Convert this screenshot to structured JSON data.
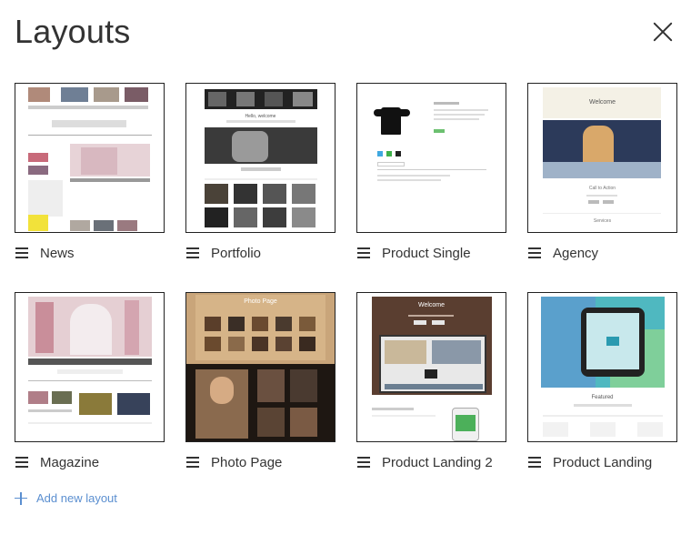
{
  "header": {
    "title": "Layouts"
  },
  "layouts": [
    {
      "label": "News"
    },
    {
      "label": "Portfolio"
    },
    {
      "label": "Product Single"
    },
    {
      "label": "Agency"
    },
    {
      "label": "Magazine"
    },
    {
      "label": "Photo Page"
    },
    {
      "label": "Product Landing 2"
    },
    {
      "label": "Product Landing"
    }
  ],
  "footer": {
    "add_label": "Add new layout"
  },
  "thumbs": {
    "portfolio_heading": "Hello, welcome",
    "agency_heading": "Welcome",
    "agency_cta": "Call to Action",
    "agency_services": "Services",
    "photo_heading": "Photo Page",
    "landing2_heading": "Welcome",
    "landing_heading": "Featured"
  },
  "colors": {
    "accent": "#5b8fd0",
    "text": "#333333"
  }
}
